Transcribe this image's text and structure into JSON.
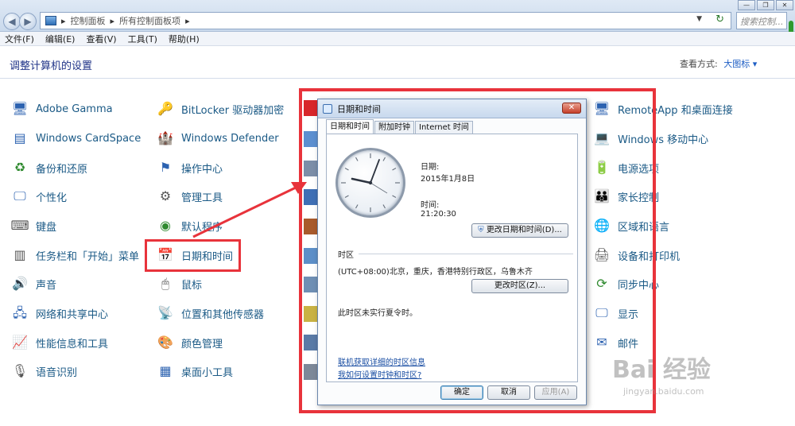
{
  "window": {
    "back_icon": "back-arrow-icon",
    "forward_icon": "forward-arrow-icon",
    "breadcrumb": [
      "控制面板",
      "所有控制面板项"
    ],
    "search_placeholder": "搜索控制...",
    "controls": [
      "minimize",
      "restore",
      "close"
    ]
  },
  "menubar": {
    "items": [
      "文件(F)",
      "编辑(E)",
      "查看(V)",
      "工具(T)",
      "帮助(H)"
    ]
  },
  "content": {
    "title": "调整计算机的设置",
    "view_by_label": "查看方式:",
    "view_by_value": "大图标 ▾"
  },
  "items": [
    {
      "label": "Adobe Gamma",
      "icon": "monitor-icon"
    },
    {
      "label": "Windows CardSpace",
      "icon": "cardspace-icon"
    },
    {
      "label": "备份和还原",
      "icon": "backup-icon"
    },
    {
      "label": "个性化",
      "icon": "personalize-icon"
    },
    {
      "label": "键盘",
      "icon": "keyboard-icon"
    },
    {
      "label": "任务栏和「开始」菜单",
      "icon": "taskbar-icon"
    },
    {
      "label": "声音",
      "icon": "speaker-icon"
    },
    {
      "label": "网络和共享中心",
      "icon": "network-icon"
    },
    {
      "label": "性能信息和工具",
      "icon": "performance-icon"
    },
    {
      "label": "语音识别",
      "icon": "microphone-icon"
    },
    {
      "label": "BitLocker 驱动器加密",
      "icon": "bitlocker-icon"
    },
    {
      "label": "Windows Defender",
      "icon": "defender-icon"
    },
    {
      "label": "操作中心",
      "icon": "flag-icon"
    },
    {
      "label": "管理工具",
      "icon": "admin-tools-icon"
    },
    {
      "label": "默认程序",
      "icon": "default-programs-icon"
    },
    {
      "label": "日期和时间",
      "icon": "calendar-clock-icon"
    },
    {
      "label": "鼠标",
      "icon": "mouse-icon"
    },
    {
      "label": "位置和其他传感器",
      "icon": "sensor-icon"
    },
    {
      "label": "颜色管理",
      "icon": "color-management-icon"
    },
    {
      "label": "桌面小工具",
      "icon": "gadgets-icon"
    },
    {
      "label": "RemoteApp 和桌面连接",
      "icon": "remoteapp-icon"
    },
    {
      "label": "Windows 移动中心",
      "icon": "mobility-icon"
    },
    {
      "label": "电源选项",
      "icon": "power-icon"
    },
    {
      "label": "家长控制",
      "icon": "parental-control-icon"
    },
    {
      "label": "区域和语言",
      "icon": "globe-icon"
    },
    {
      "label": "设备和打印机",
      "icon": "printer-icon"
    },
    {
      "label": "同步中心",
      "icon": "sync-icon"
    },
    {
      "label": "显示",
      "icon": "display-icon"
    },
    {
      "label": "邮件",
      "icon": "mail-icon"
    }
  ],
  "dialog": {
    "title": "日期和时间",
    "tabs": [
      "日期和时间",
      "附加时钟",
      "Internet 时间"
    ],
    "date_label": "日期:",
    "date_value": "2015年1月8日",
    "time_label": "时间:",
    "time_value": "21:20:30",
    "change_datetime_button": "更改日期和时间(D)...",
    "timezone_heading": "时区",
    "timezone_value": "(UTC+08:00)北京，重庆，香港特别行政区，乌鲁木齐",
    "change_timezone_button": "更改时区(Z)...",
    "dst_note": "此时区未实行夏令时。",
    "link_online": "联机获取详细的时区信息",
    "link_howto": "我如何设置时钟和时区?",
    "ok_button": "确定",
    "cancel_button": "取消",
    "apply_button": "应用(A)"
  },
  "watermark": {
    "brand": "Bai 经验",
    "url": "jingyan.baidu.com"
  }
}
